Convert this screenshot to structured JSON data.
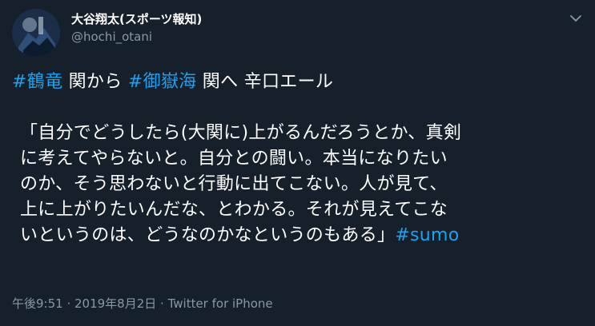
{
  "user": {
    "display_name": "大谷翔太(スポーツ報知)",
    "handle": "@hochi_otani"
  },
  "tweet": {
    "line1": {
      "hashtag1": "#鶴竜",
      "text1": " 関から ",
      "hashtag2": "#御嶽海",
      "text2": " 関へ 辛口エール"
    },
    "body_lines": [
      "「自分でどうしたら(大関に)上がるんだろうとか、真剣",
      "に考えてやらないと。自分との闘い。本当になりたい",
      "のか、そう思わないと行動に出てこない。人が見て、",
      "上に上がりたいんだな、とわかる。それが見えてこな"
    ],
    "last_line": {
      "text": "いというのは、どうなのかなというのもある」",
      "hashtag": "#sumo"
    }
  },
  "meta": {
    "time": "午後9:51",
    "separator1": " · ",
    "date": "2019年8月2日",
    "separator2": " · ",
    "source": "Twitter for iPhone"
  },
  "colors": {
    "background": "#15202b",
    "text": "#ffffff",
    "secondary": "#8899a6",
    "accent": "#1da1f2"
  },
  "icons": {
    "caret": "chevron-down-icon"
  }
}
